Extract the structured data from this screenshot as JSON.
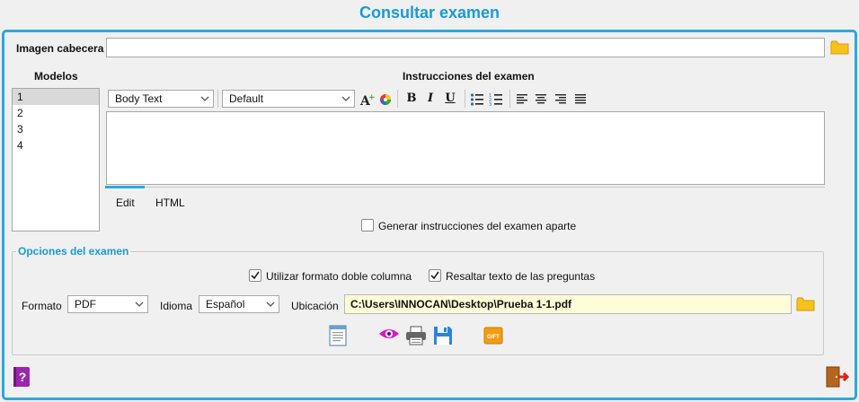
{
  "window": {
    "title": "Consultar examen"
  },
  "header_image": {
    "label": "Imagen cabecera",
    "value": ""
  },
  "models": {
    "label": "Modelos",
    "items": [
      "1",
      "2",
      "3",
      "4"
    ],
    "selected_index": 0
  },
  "instructions": {
    "label": "Instrucciones del examen",
    "style_value": "Body Text",
    "font_value": "Default",
    "toolbar": {
      "bold": "B",
      "italic": "I",
      "underline": "U"
    },
    "content": "",
    "tabs": [
      {
        "label": "Edit",
        "active": true
      },
      {
        "label": "HTML",
        "active": false
      }
    ],
    "separate_checkbox": {
      "label": "Generar instrucciones del examen aparte",
      "checked": false
    }
  },
  "options": {
    "legend": "Opciones del examen",
    "double_column": {
      "label": "Utilizar formato doble columna",
      "checked": true
    },
    "highlight": {
      "label": "Resaltar texto de las preguntas",
      "checked": true
    },
    "format": {
      "label": "Formato",
      "value": "PDF"
    },
    "language": {
      "label": "Idioma",
      "value": "Español"
    },
    "location": {
      "label": "Ubicación",
      "value": "C:\\Users\\INNOCAN\\Desktop\\Prueba 1-1.pdf"
    },
    "gift_label": "GIFT"
  },
  "colors": {
    "accent": "#2aa8e0",
    "title": "#1a9ad6",
    "path_bg": "#fffcd8"
  }
}
